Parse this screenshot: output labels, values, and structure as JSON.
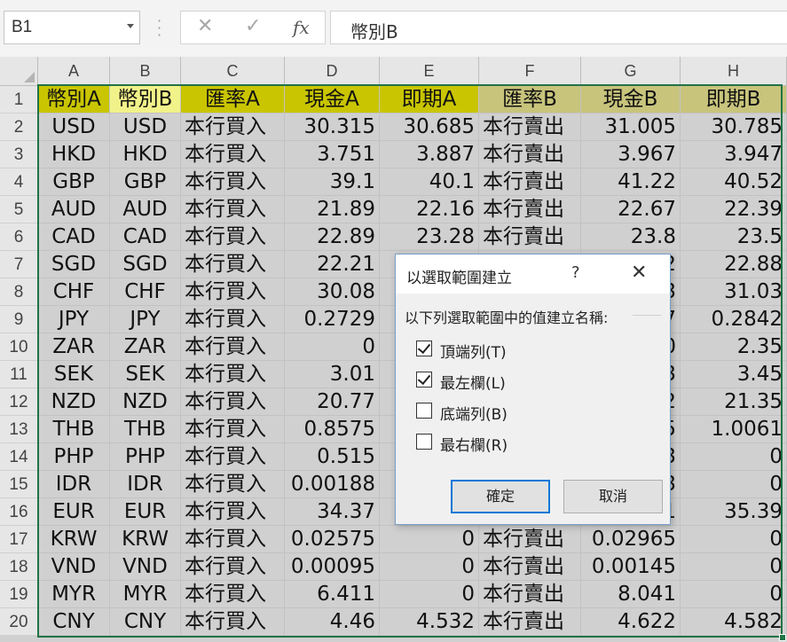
{
  "formula_bar": {
    "name_box": "B1",
    "cancel_icon": "✕",
    "enter_icon": "✓",
    "fx_label": "fx",
    "formula": "幣別B"
  },
  "columns": [
    "A",
    "B",
    "C",
    "D",
    "E",
    "F",
    "G",
    "H"
  ],
  "rows": [
    {
      "num": "1",
      "cells": [
        "幣別A",
        "幣別B",
        "匯率A",
        "現金A",
        "即期A",
        "匯率B",
        "現金B",
        "即期B"
      ]
    },
    {
      "num": "2",
      "cells": [
        "USD",
        "USD",
        "本行買入",
        "30.315",
        "30.685",
        "本行賣出",
        "31.005",
        "30.785"
      ]
    },
    {
      "num": "3",
      "cells": [
        "HKD",
        "HKD",
        "本行買入",
        "3.751",
        "3.887",
        "本行賣出",
        "3.967",
        "3.947"
      ]
    },
    {
      "num": "4",
      "cells": [
        "GBP",
        "GBP",
        "本行買入",
        "39.1",
        "40.1",
        "本行賣出",
        "41.22",
        "40.52"
      ]
    },
    {
      "num": "5",
      "cells": [
        "AUD",
        "AUD",
        "本行買入",
        "21.89",
        "22.16",
        "本行賣出",
        "22.67",
        "22.39"
      ]
    },
    {
      "num": "6",
      "cells": [
        "CAD",
        "CAD",
        "本行買入",
        "22.89",
        "23.28",
        "本行賣出",
        "23.8",
        "23.5"
      ]
    },
    {
      "num": "7",
      "cells": [
        "SGD",
        "SGD",
        "本行買入",
        "22.21",
        "",
        "",
        "2",
        "22.88"
      ]
    },
    {
      "num": "8",
      "cells": [
        "CHF",
        "CHF",
        "本行買入",
        "30.08",
        "",
        "",
        "3",
        "31.03"
      ]
    },
    {
      "num": "9",
      "cells": [
        "JPY",
        "JPY",
        "本行買入",
        "0.2729",
        "",
        "",
        "7",
        "0.2842"
      ]
    },
    {
      "num": "10",
      "cells": [
        "ZAR",
        "ZAR",
        "本行買入",
        "0",
        "",
        "",
        "0",
        "2.35"
      ]
    },
    {
      "num": "11",
      "cells": [
        "SEK",
        "SEK",
        "本行買入",
        "3.01",
        "",
        "",
        "3",
        "3.45"
      ]
    },
    {
      "num": "12",
      "cells": [
        "NZD",
        "NZD",
        "本行買入",
        "20.77",
        "",
        "",
        "2",
        "21.35"
      ]
    },
    {
      "num": "13",
      "cells": [
        "THB",
        "THB",
        "本行買入",
        "0.8575",
        "",
        "",
        "5",
        "1.0061"
      ]
    },
    {
      "num": "14",
      "cells": [
        "PHP",
        "PHP",
        "本行買入",
        "0.515",
        "",
        "",
        "3",
        "0"
      ]
    },
    {
      "num": "15",
      "cells": [
        "IDR",
        "IDR",
        "本行買入",
        "0.00188",
        "",
        "",
        "3",
        "0"
      ]
    },
    {
      "num": "16",
      "cells": [
        "EUR",
        "EUR",
        "本行買入",
        "34.37",
        "",
        "",
        "1",
        "35.39"
      ]
    },
    {
      "num": "17",
      "cells": [
        "KRW",
        "KRW",
        "本行買入",
        "0.02575",
        "0",
        "本行賣出",
        "0.02965",
        "0"
      ]
    },
    {
      "num": "18",
      "cells": [
        "VND",
        "VND",
        "本行買入",
        "0.00095",
        "0",
        "本行賣出",
        "0.00145",
        "0"
      ]
    },
    {
      "num": "19",
      "cells": [
        "MYR",
        "MYR",
        "本行買入",
        "6.411",
        "0",
        "本行賣出",
        "8.041",
        "0"
      ]
    },
    {
      "num": "20",
      "cells": [
        "CNY",
        "CNY",
        "本行買入",
        "4.46",
        "4.532",
        "本行賣出",
        "4.622",
        "4.582"
      ]
    }
  ],
  "colors": {
    "header_yellow": "#c9c500",
    "header_light_yellow": "#f2f28a",
    "header_olive": "#c8c47c",
    "selection_border": "#217346",
    "selection_fill": "#d0d0d0"
  },
  "dialog": {
    "title": "以選取範圍建立",
    "help": "?",
    "close": "✕",
    "prompt": "以下列選取範圍中的值建立名稱:",
    "options": [
      {
        "label": "頂端列(T)",
        "checked": true
      },
      {
        "label": "最左欄(L)",
        "checked": true
      },
      {
        "label": "底端列(B)",
        "checked": false
      },
      {
        "label": "最右欄(R)",
        "checked": false
      }
    ],
    "ok": "確定",
    "cancel": "取消"
  }
}
